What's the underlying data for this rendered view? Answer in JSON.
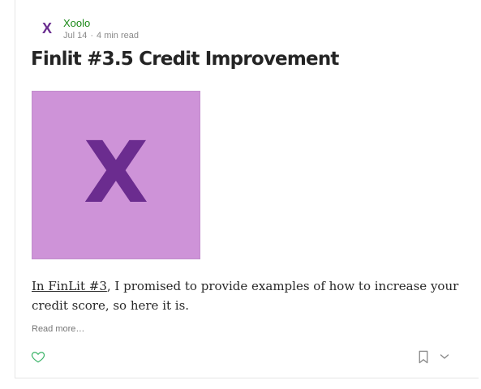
{
  "post": {
    "author": "Xoolo",
    "avatar_letter": "X",
    "date": "Jul 14",
    "separator": "·",
    "read_time": "4 min read",
    "title": "Finlit #3.5 Credit Improvement",
    "image_letter": "X",
    "body_link": "In FinLit #3",
    "body_rest": ", I promised to provide examples of how to increase your credit score, so here it is.",
    "read_more": "Read more…"
  },
  "colors": {
    "author": "#1a8917",
    "brand_purple": "#6b2c8f",
    "image_bg": "#ce93d8",
    "heart": "#3fb56b"
  },
  "icons": {
    "like": "heart-icon",
    "bookmark": "bookmark-icon",
    "more": "chevron-down-icon"
  }
}
